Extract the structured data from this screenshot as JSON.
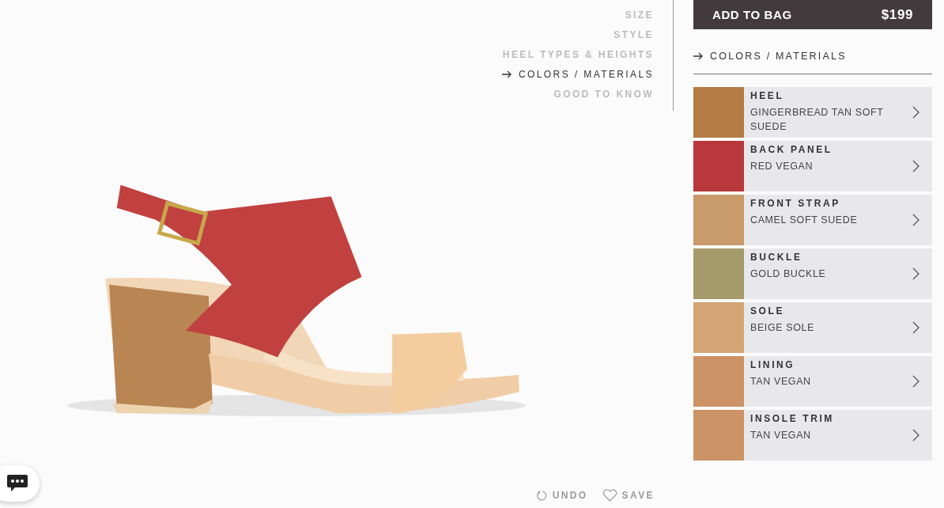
{
  "steps_nav": [
    {
      "label": "SIZE",
      "selected": false
    },
    {
      "label": "STYLE",
      "selected": false
    },
    {
      "label": "HEEL TYPES & HEIGHTS",
      "selected": false
    },
    {
      "label": "COLORS / MATERIALS",
      "selected": true
    },
    {
      "label": "GOOD TO KNOW",
      "selected": false
    }
  ],
  "add_to_bag": {
    "label": "ADD TO BAG",
    "price": "$199"
  },
  "section_title": "COLORS / MATERIALS",
  "materials": [
    {
      "part": "HEEL",
      "material": "GINGERBREAD TAN SOFT SUEDE",
      "color": "#b57b45"
    },
    {
      "part": "BACK PANEL",
      "material": "RED VEGAN",
      "color": "#b8383b"
    },
    {
      "part": "FRONT STRAP",
      "material": "CAMEL SOFT SUEDE",
      "color": "#c99a6a"
    },
    {
      "part": "BUCKLE",
      "material": "GOLD BUCKLE",
      "color": "#a59a6a"
    },
    {
      "part": "SOLE",
      "material": "BEIGE SOLE",
      "color": "#d4a474"
    },
    {
      "part": "LINING",
      "material": "TAN VEGAN",
      "color": "#cc9367"
    },
    {
      "part": "INSOLE TRIM",
      "material": "TAN VEGAN",
      "color": "#cc9367"
    }
  ],
  "actions": [
    {
      "kind": "undo",
      "label": "UNDO"
    },
    {
      "kind": "save",
      "label": "SAVE"
    }
  ]
}
